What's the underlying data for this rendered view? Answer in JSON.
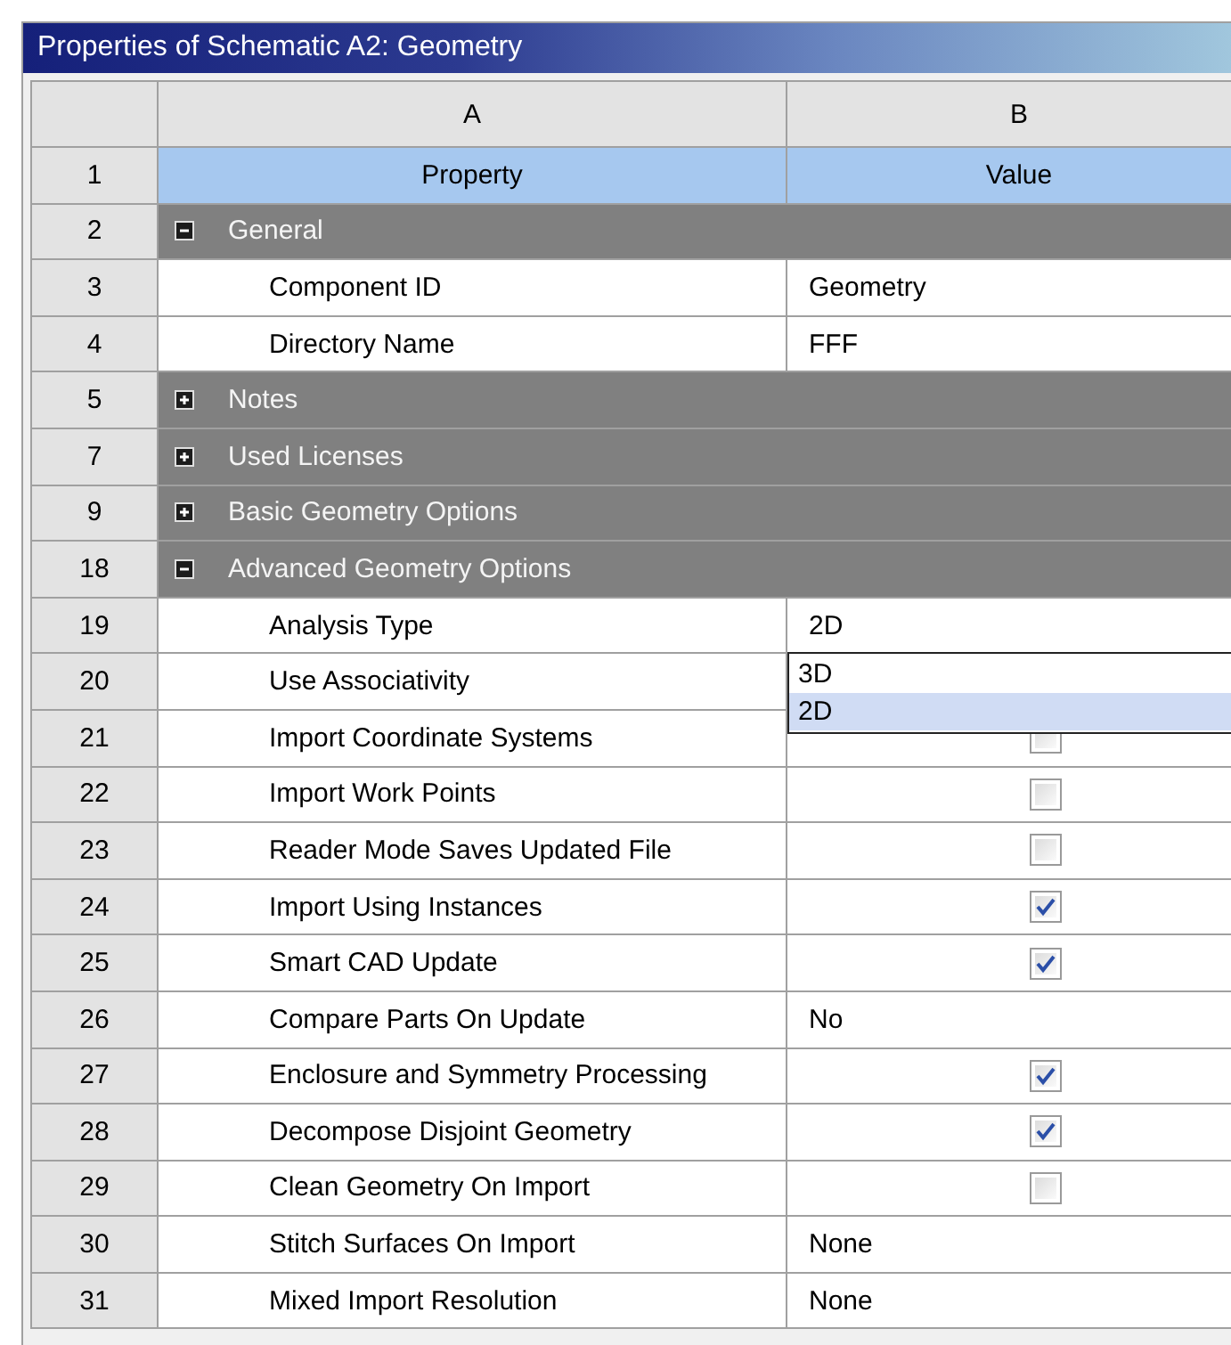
{
  "panel": {
    "title": "Properties of Schematic A2: Geometry"
  },
  "columns": [
    {
      "label": "A"
    },
    {
      "label": "B"
    }
  ],
  "rows": [
    {
      "num": "1",
      "kind": "header",
      "property": "Property",
      "value": "Value"
    },
    {
      "num": "2",
      "kind": "group",
      "label": "General",
      "expanded": true
    },
    {
      "num": "3",
      "kind": "text",
      "property": "Component ID",
      "value": "Geometry"
    },
    {
      "num": "4",
      "kind": "text",
      "property": "Directory Name",
      "value": "FFF"
    },
    {
      "num": "5",
      "kind": "group",
      "label": "Notes",
      "expanded": false
    },
    {
      "num": "7",
      "kind": "group",
      "label": "Used Licenses",
      "expanded": false
    },
    {
      "num": "9",
      "kind": "group",
      "label": "Basic Geometry Options",
      "expanded": false
    },
    {
      "num": "18",
      "kind": "group",
      "label": "Advanced Geometry Options",
      "expanded": true
    },
    {
      "num": "19",
      "kind": "dropdown",
      "property": "Analysis Type",
      "value": "2D",
      "options": [
        {
          "label": "3D",
          "selected": false
        },
        {
          "label": "2D",
          "selected": true
        }
      ]
    },
    {
      "num": "20",
      "kind": "covered",
      "property": "Use Associativity"
    },
    {
      "num": "21",
      "kind": "checkbox",
      "property": "Import Coordinate Systems",
      "checked": false
    },
    {
      "num": "22",
      "kind": "checkbox",
      "property": "Import Work Points",
      "checked": false
    },
    {
      "num": "23",
      "kind": "checkbox",
      "property": "Reader Mode Saves Updated File",
      "checked": false
    },
    {
      "num": "24",
      "kind": "checkbox",
      "property": "Import Using Instances",
      "checked": true
    },
    {
      "num": "25",
      "kind": "checkbox",
      "property": "Smart CAD Update",
      "checked": true
    },
    {
      "num": "26",
      "kind": "text",
      "property": "Compare Parts On Update",
      "value": "No"
    },
    {
      "num": "27",
      "kind": "checkbox",
      "property": "Enclosure and Symmetry Processing",
      "checked": true
    },
    {
      "num": "28",
      "kind": "checkbox",
      "property": "Decompose Disjoint Geometry",
      "checked": true
    },
    {
      "num": "29",
      "kind": "checkbox",
      "property": "Clean Geometry On Import",
      "checked": false
    },
    {
      "num": "30",
      "kind": "text",
      "property": "Stitch Surfaces On Import",
      "value": "None"
    },
    {
      "num": "31",
      "kind": "text",
      "property": "Mixed Import Resolution",
      "value": "None"
    }
  ]
}
